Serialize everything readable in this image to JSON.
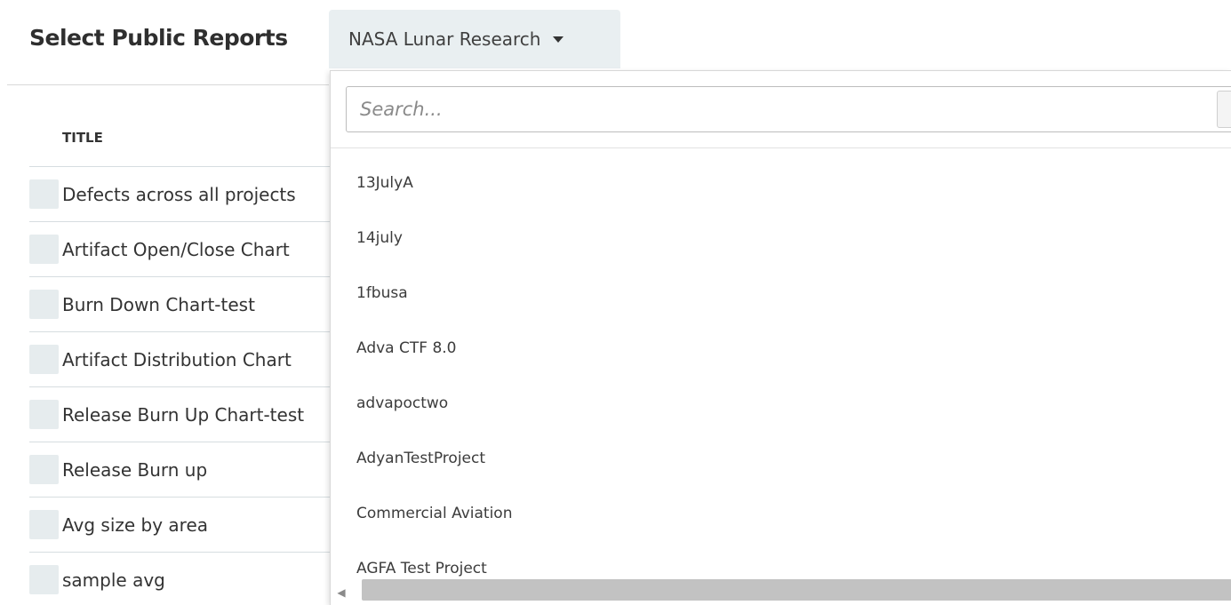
{
  "header": {
    "title": "Select Public Reports",
    "project_select": {
      "selected": "NASA Lunar Research"
    }
  },
  "table": {
    "column_title": "TITLE",
    "rows": [
      {
        "title": "Defects across all projects"
      },
      {
        "title": "Artifact Open/Close Chart"
      },
      {
        "title": "Burn Down Chart-test"
      },
      {
        "title": "Artifact Distribution Chart"
      },
      {
        "title": "Release Burn Up Chart-test"
      },
      {
        "title": "Release Burn up"
      },
      {
        "title": "Avg size by area"
      },
      {
        "title": "sample avg"
      }
    ]
  },
  "dropdown": {
    "search_placeholder": "Search...",
    "options": [
      "13JulyA",
      "14july",
      "1fbusa",
      "Adva CTF 8.0",
      "advapoctwo",
      "AdyanTestProject",
      "Commercial Aviation",
      "AGFA Test Project"
    ]
  },
  "colors": {
    "select_bg": "#e9eff1",
    "checkbox_bg": "#e6ecee",
    "scroll_thumb": "#c2c2c2"
  },
  "icons": {
    "caret": "chevron-down-icon",
    "scroll_left": "scroll-left-arrow-icon"
  }
}
